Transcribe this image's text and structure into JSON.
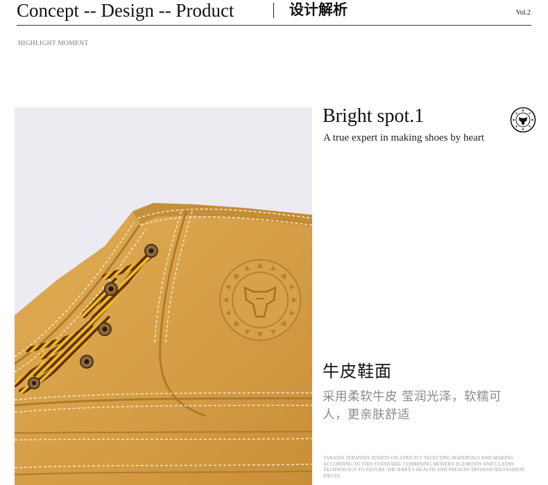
{
  "header": {
    "title": "Concept -- Design -- Product",
    "subtitle_cn": "设计解析",
    "volume": "Vol.2"
  },
  "section_label": "HIGHLIGHT MOMENT",
  "spot": {
    "title": "Bright spot.1",
    "subtitle": "A true expert in making shoes by heart"
  },
  "feature": {
    "title_cn": "牛皮鞋面",
    "desc_cn_line1": "采用柔软牛皮 莹润光泽，软糯可",
    "desc_cn_line2": "人，更亲肤舒适"
  },
  "fine_print": "TARANIS TERANNIS INSISTS ON STRICTLY SELECTING MATERIALS AND MAKING ACCORDING TO THIS STANDARD. COMBINING MODERN ELEMENTS AND CLASSIC TECHNOLOGY TO ENSURE THE BABY'S HEALTH AND PRESENT DIVERSIFIED FASHION PIECES.",
  "colors": {
    "leather": "#d9a44c",
    "photo_background": "#ecebf2",
    "lace_brown": "#6b2e14",
    "lace_yellow": "#e8c020"
  }
}
